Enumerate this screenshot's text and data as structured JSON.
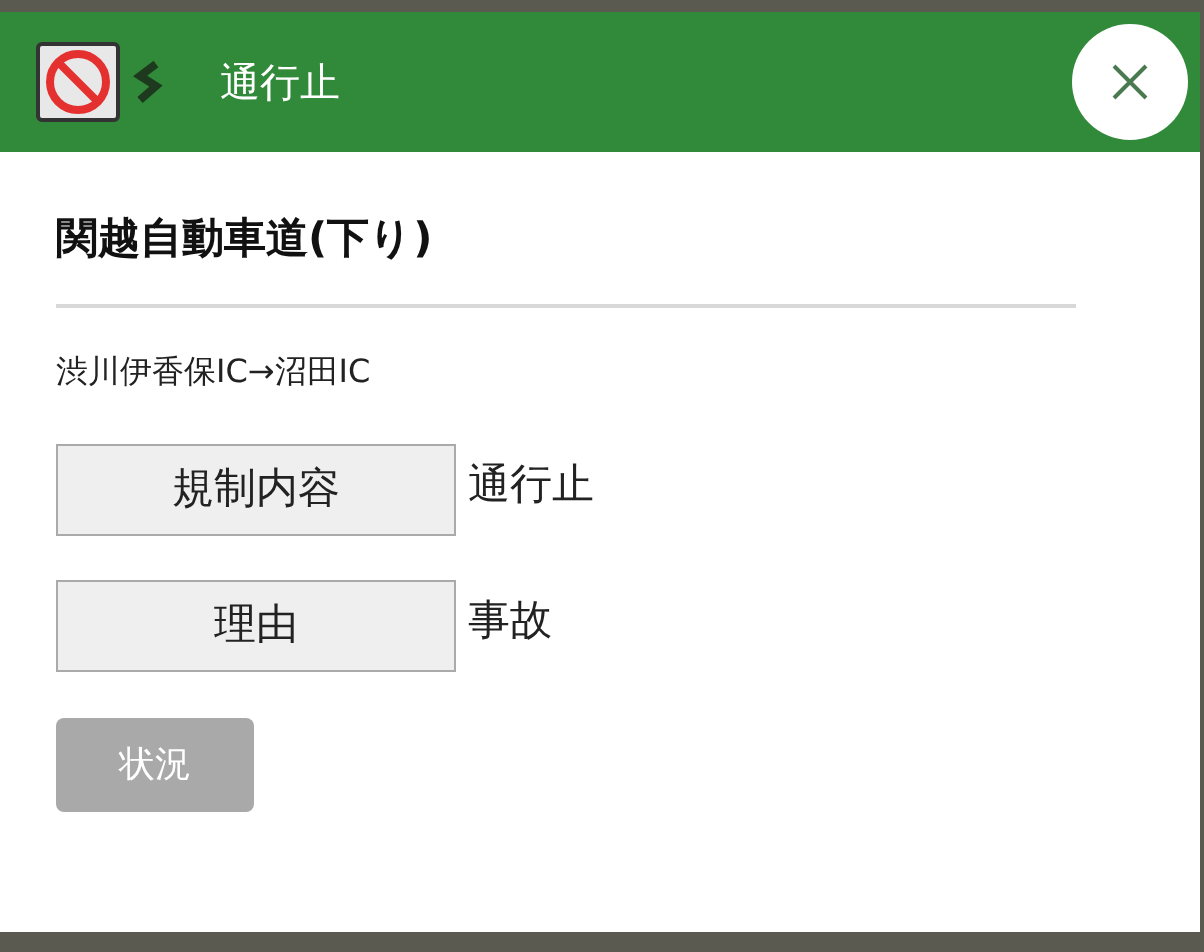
{
  "header": {
    "title": "通行止"
  },
  "road": {
    "name": "関越自動車道(下り)",
    "section": "渋川伊香保IC→沼田IC"
  },
  "details": [
    {
      "label": "規制内容",
      "value": "通行止"
    },
    {
      "label": "理由",
      "value": "事故"
    }
  ],
  "status_button": {
    "label": "状況",
    "disabled": true
  }
}
